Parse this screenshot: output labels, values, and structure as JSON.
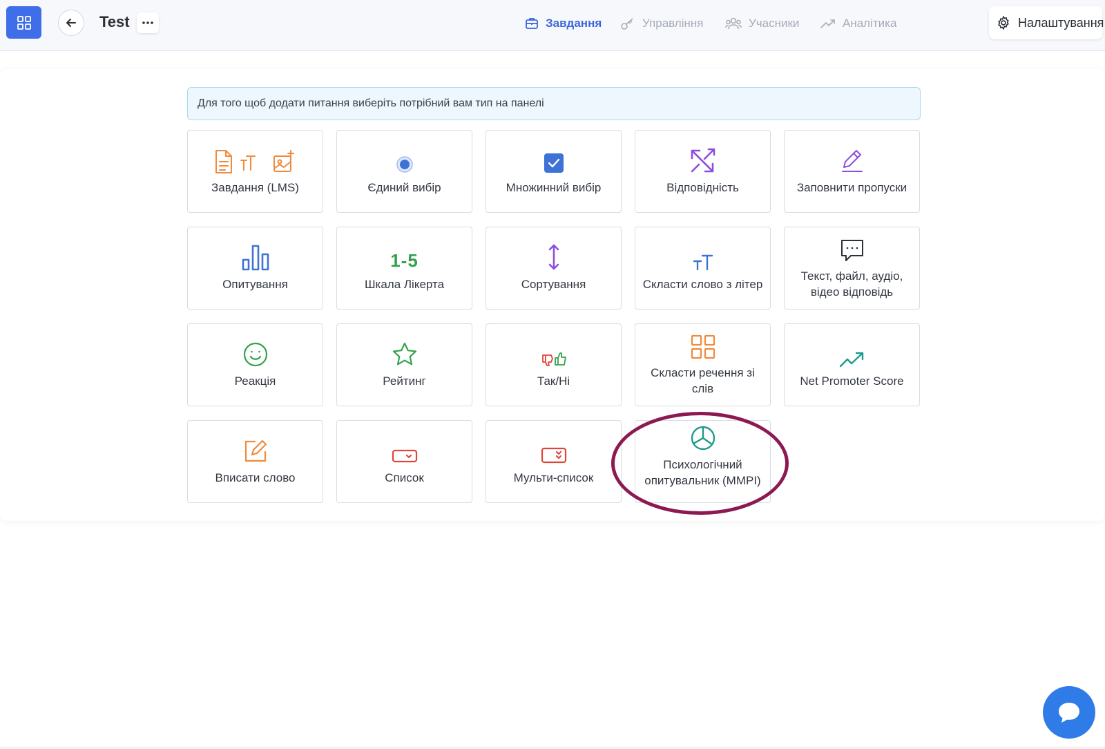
{
  "header": {
    "title": "Test",
    "more_label": "···",
    "nav": [
      {
        "label": "Завдання",
        "icon": "briefcase-icon",
        "active": true
      },
      {
        "label": "Управління",
        "icon": "key-icon",
        "active": false
      },
      {
        "label": "Учасники",
        "icon": "users-icon",
        "active": false
      },
      {
        "label": "Аналітика",
        "icon": "trend-icon",
        "active": false
      }
    ],
    "settings_label": "Налаштування"
  },
  "hint": "Для того щоб додати питання виберіть потрібний вам тип на панелі",
  "tiles": [
    {
      "label": "Завдання (LMS)",
      "icon": "lms-icons"
    },
    {
      "label": "Єдиний вибір",
      "icon": "radio-icon"
    },
    {
      "label": "Множинний вибір",
      "icon": "checkbox-icon"
    },
    {
      "label": "Відповідність",
      "icon": "match-arrows-icon"
    },
    {
      "label": "Заповнити пропуски",
      "icon": "pencil-icon"
    },
    {
      "label": "Опитування",
      "icon": "bar-chart-icon"
    },
    {
      "label": "Шкала Лікерта",
      "icon": "likert-icon",
      "icon_text": "1-5"
    },
    {
      "label": "Сортування",
      "icon": "sort-arrows-icon"
    },
    {
      "label": "Скласти слово з літер",
      "icon": "text-size-icon"
    },
    {
      "label": "Текст, файл, аудіо, відео відповідь",
      "icon": "speech-bubble-icon"
    },
    {
      "label": "Реакція",
      "icon": "smile-icon"
    },
    {
      "label": "Рейтинг",
      "icon": "star-icon"
    },
    {
      "label": "Так/Ні",
      "icon": "thumbs-icon"
    },
    {
      "label": "Скласти речення зі слів",
      "icon": "grid-icon"
    },
    {
      "label": "Net Promoter Score",
      "icon": "trend-up-icon"
    },
    {
      "label": "Вписати слово",
      "icon": "edit-icon"
    },
    {
      "label": "Список",
      "icon": "dropdown-icon"
    },
    {
      "label": "Мульти-список",
      "icon": "multi-dropdown-icon"
    },
    {
      "label": "Психологічний опитувальник (MMPI)",
      "icon": "pie-chart-icon"
    }
  ],
  "colors": {
    "accent": "#3f6ee8",
    "highlight_ring": "#8c1a52",
    "orange": "#f08a3c",
    "blue": "#3f72d6",
    "purple": "#8b4fe0",
    "green": "#33a24a",
    "teal": "#1e9a8a",
    "red": "#e0453a"
  }
}
